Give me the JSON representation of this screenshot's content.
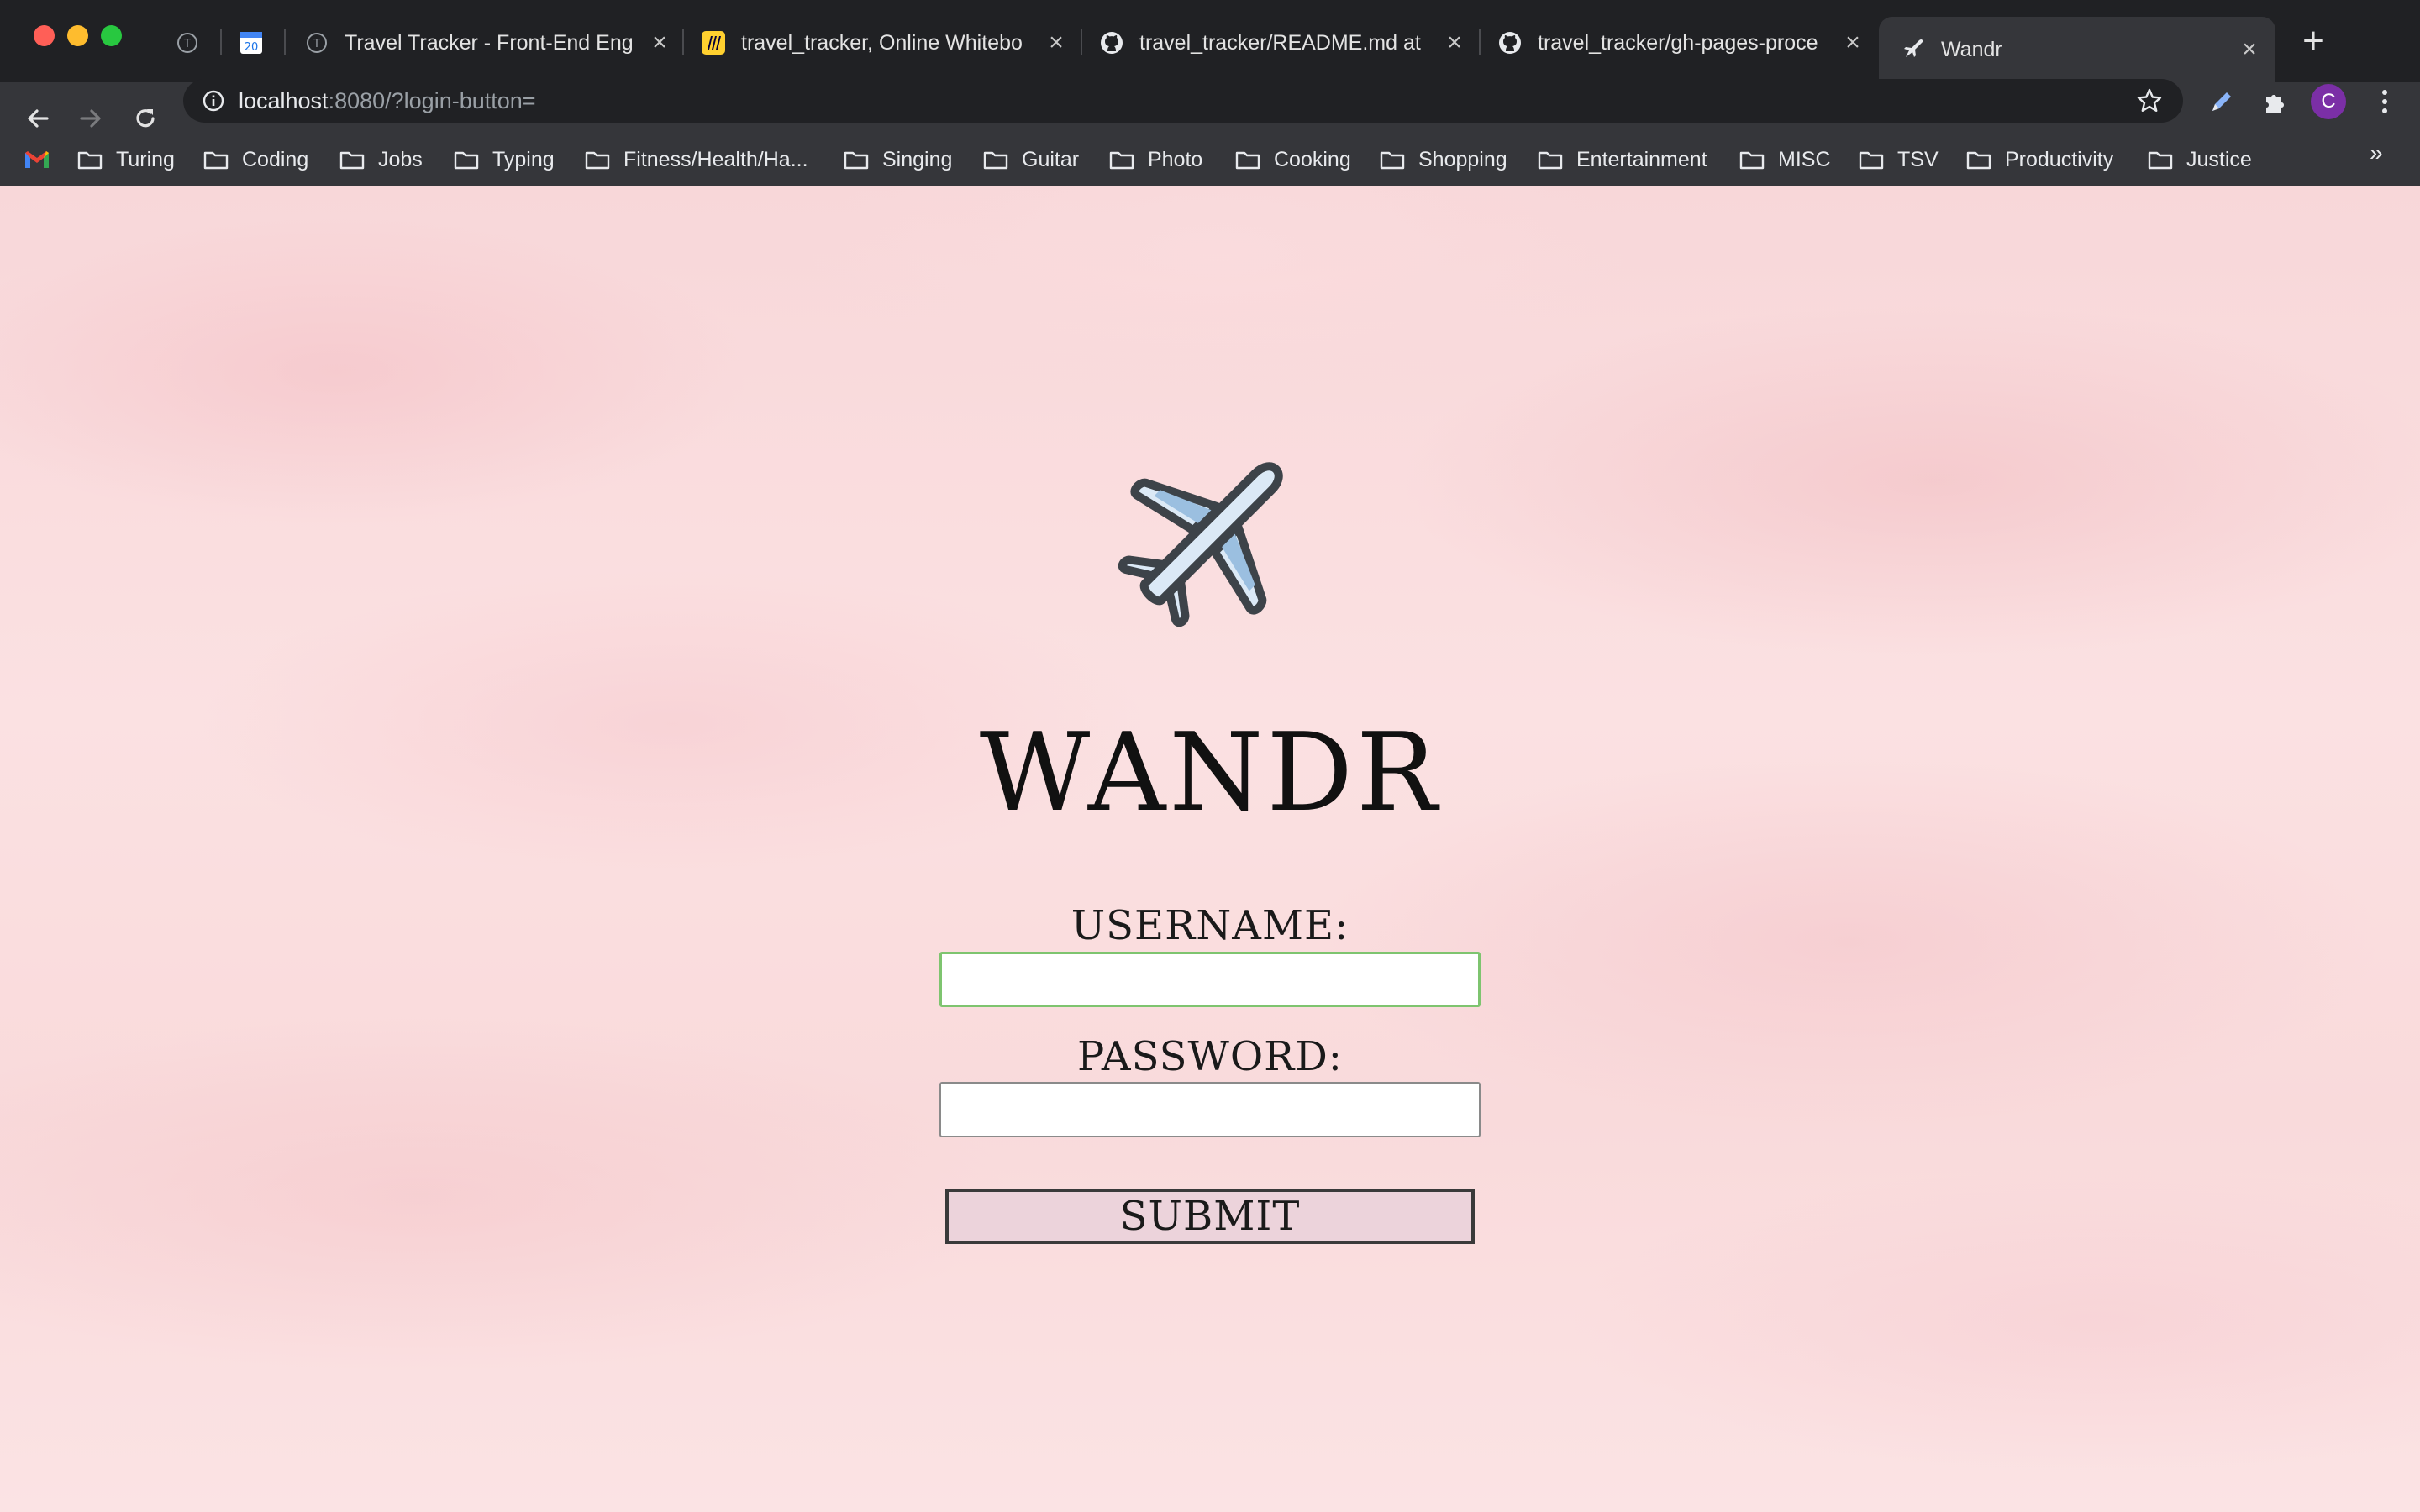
{
  "browser": {
    "tabs": [
      {
        "title": "",
        "icon": "turing-icon",
        "active": false
      },
      {
        "title": "",
        "icon": "calendar-icon",
        "active": false
      },
      {
        "title": "Travel Tracker - Front-End Eng",
        "icon": "turing-icon",
        "active": false
      },
      {
        "title": "travel_tracker, Online Whitebo",
        "icon": "miro-icon",
        "active": false
      },
      {
        "title": "travel_tracker/README.md at",
        "icon": "github-icon",
        "active": false
      },
      {
        "title": "travel_tracker/gh-pages-proce",
        "icon": "github-icon",
        "active": false
      },
      {
        "title": "Wandr",
        "icon": "plane-icon",
        "active": true
      }
    ],
    "calendar_day": "20",
    "url_host": "localhost",
    "url_rest": ":8080/?login-button=",
    "profile_initial": "C",
    "bookmarks": [
      {
        "label": "Turing"
      },
      {
        "label": "Coding"
      },
      {
        "label": "Jobs"
      },
      {
        "label": "Typing"
      },
      {
        "label": "Fitness/Health/Ha..."
      },
      {
        "label": "Singing"
      },
      {
        "label": "Guitar"
      },
      {
        "label": "Photo"
      },
      {
        "label": "Cooking"
      },
      {
        "label": "Shopping"
      },
      {
        "label": "Entertainment"
      },
      {
        "label": "MISC"
      },
      {
        "label": "TSV"
      },
      {
        "label": "Productivity"
      },
      {
        "label": "Justice"
      }
    ],
    "bookmarks_more": "»"
  },
  "login": {
    "app_title": "WANDR",
    "username_label": "USERNAME:",
    "username_value": "",
    "password_label": "PASSWORD:",
    "password_value": "",
    "submit_label": "SUBMIT"
  },
  "colors": {
    "background": "#fbe3e4",
    "focus_border": "#7ec46f",
    "submit_fill": "#ecd3db",
    "plane_fill": "#dbe9f6",
    "plane_stroke": "#3d4349"
  }
}
